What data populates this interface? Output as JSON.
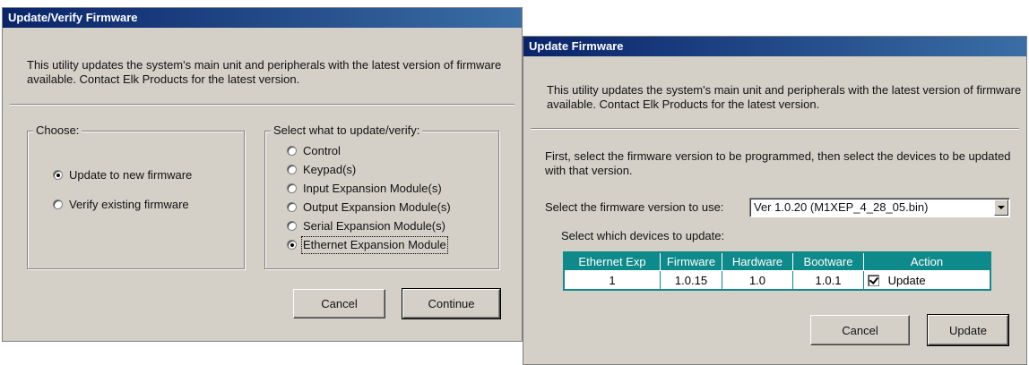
{
  "left_dialog": {
    "title": "Update/Verify Firmware",
    "description": "This utility updates the system's main unit and peripherals with the latest version of firmware available.  Contact Elk Products for the latest version.",
    "choose": {
      "label": "Choose:",
      "options": [
        {
          "label": "Update to new firmware",
          "selected": true
        },
        {
          "label": "Verify existing firmware",
          "selected": false
        }
      ]
    },
    "select_group": {
      "label": "Select what to update/verify:",
      "options": [
        {
          "label": "Control",
          "selected": false
        },
        {
          "label": "Keypad(s)",
          "selected": false
        },
        {
          "label": "Input Expansion Module(s)",
          "selected": false
        },
        {
          "label": "Output Expansion Module(s)",
          "selected": false
        },
        {
          "label": "Serial Expansion Module(s)",
          "selected": false
        },
        {
          "label": "Ethernet Expansion Module",
          "selected": true
        }
      ]
    },
    "buttons": {
      "cancel": "Cancel",
      "continue": "Continue"
    }
  },
  "right_dialog": {
    "title": "Update Firmware",
    "description": "This utility updates the system's main unit and peripherals with the latest version of firmware available.  Contact Elk Products for the latest version.",
    "instruction": "First, select the firmware version to be programmed, then select the devices to be updated with that version.",
    "version_label": "Select the firmware version to use:",
    "version_value": "Ver 1.0.20 (M1XEP_4_28_05.bin)",
    "devices_label": "Select which devices to update:",
    "table": {
      "headers": [
        "Ethernet Exp",
        "Firmware",
        "Hardware",
        "Bootware",
        "Action"
      ],
      "rows": [
        {
          "device": "1",
          "firmware": "1.0.15",
          "hardware": "1.0",
          "bootware": "1.0.1",
          "action": "Update",
          "checked": true
        }
      ]
    },
    "buttons": {
      "cancel": "Cancel",
      "update": "Update"
    }
  },
  "colors": {
    "title_bar": "#0a246a",
    "dialog_face": "#d4d0c8",
    "table_header": "#0f8a8a"
  }
}
